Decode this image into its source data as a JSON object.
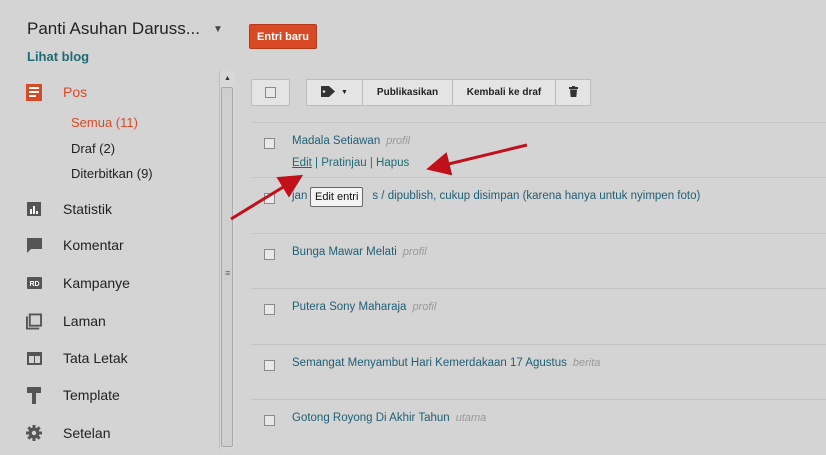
{
  "header": {
    "blog_title": "Panti Asuhan Daruss...",
    "view_blog": "Lihat blog",
    "new_post": "Entri baru"
  },
  "sidebar": {
    "items": [
      {
        "label": "Pos",
        "icon": "posts-icon",
        "active": true
      },
      {
        "label": "Statistik",
        "icon": "stats-icon"
      },
      {
        "label": "Komentar",
        "icon": "comments-icon"
      },
      {
        "label": "Kampanye",
        "icon": "campaigns-icon"
      },
      {
        "label": "Laman",
        "icon": "pages-icon"
      },
      {
        "label": "Tata Letak",
        "icon": "layout-icon"
      },
      {
        "label": "Template",
        "icon": "template-icon"
      },
      {
        "label": "Setelan",
        "icon": "settings-icon"
      }
    ],
    "sub_items": [
      {
        "label": "Semua (11)",
        "active": true
      },
      {
        "label": "Draf (2)"
      },
      {
        "label": "Diterbitkan (9)"
      }
    ],
    "campaign_badge": "RD"
  },
  "toolbar": {
    "publish": "Publikasikan",
    "revert": "Kembali ke draf"
  },
  "posts": [
    {
      "title": "Madala Setiawan",
      "label": "profil"
    },
    {
      "title_prefix": "jan",
      "title_suffix": "s / dipublish, cukup disimpan (karena hanya untuk nyimpen foto)",
      "label": ""
    },
    {
      "title": "Bunga Mawar Melati",
      "label": "profil"
    },
    {
      "title": "Putera Sony Maharaja",
      "label": "profil"
    },
    {
      "title": "Semangat Menyambut Hari Kemerdakaan 17 Agustus",
      "label": "berita"
    },
    {
      "title": "Gotong Royong Di Akhir Tahun",
      "label": "utama"
    }
  ],
  "row_actions": {
    "edit": "Edit",
    "preview": "Pratinjau",
    "delete": "Hapus",
    "separator": "|"
  },
  "tooltip": "Edit entri",
  "colors": {
    "accent": "#d84a26",
    "link": "#1f6b75",
    "arrow": "#c0101a",
    "background": "#d4d4d4"
  }
}
